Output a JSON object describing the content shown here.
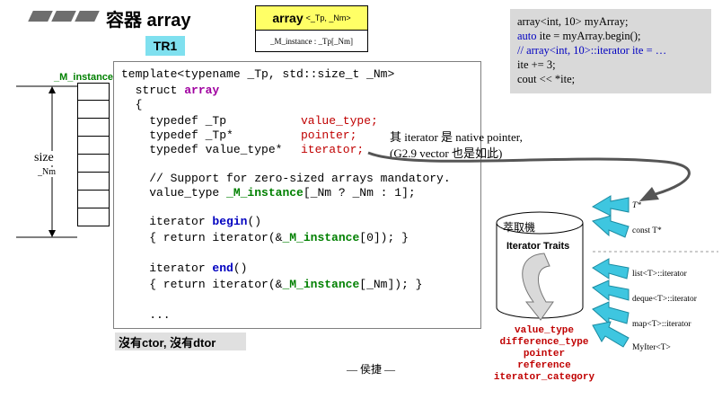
{
  "header": {
    "title": "容器 array",
    "tag": "TR1"
  },
  "array_box": {
    "name": "array",
    "params": "<_Tp, _Nm>",
    "member": "_M_instance : _Tp[_Nm]"
  },
  "memory": {
    "label": "_M_instance",
    "size_label": "size",
    "nm_label": "_Nm"
  },
  "code": {
    "l1": "template<typename _Tp, std::size_t _Nm>",
    "l2a": "  struct ",
    "l2b": "array",
    "l3": "  {",
    "l4a": "    typedef _Tp",
    "l4b": "value_type;",
    "l5a": "    typedef _Tp*",
    "l5b": "pointer;",
    "l6a": "    typedef value_type*",
    "l6b": "iterator;",
    "l7": "    // Support for zero-sized arrays mandatory.",
    "l8a": "    value_type ",
    "l8b": "_M_instance",
    "l8c": "[_Nm ? _Nm : 1];",
    "l9a": "    iterator ",
    "l9b": "begin",
    "l9c": "()",
    "l10a": "    { return iterator(&",
    "l10b": "_M_instance",
    "l10c": "[0]); }",
    "l11a": "    iterator ",
    "l11b": "end",
    "l11c": "()",
    "l12a": "    { return iterator(&",
    "l12b": "_M_instance",
    "l12c": "[_Nm]); }",
    "l13": "    ..."
  },
  "notes": {
    "n1": "其 iterator 是 native pointer,",
    "n2": "(G2.9 vector 也是如此)"
  },
  "no_ctor": "沒有ctor, 沒有dtor",
  "footer": "— 侯捷 —",
  "example": {
    "e1": "array<int, 10> myArray;",
    "e2a": "auto",
    "e2b": " ite = myArray.begin();",
    "e3": "  // array<int, 10>::iterator ite = …",
    "e4": "ite += 3;",
    "e5": "cout << *ite;"
  },
  "traits": {
    "extractor": "萃取機",
    "name": "Iterator Traits",
    "inputs": [
      "T*",
      "const T*",
      "list<T>::iterator",
      "deque<T>::iterator",
      "map<T>::iterator",
      "MyIter<T>"
    ],
    "outputs": [
      "value_type",
      "difference_type",
      "pointer",
      "reference",
      "iterator_category"
    ]
  },
  "colors": {
    "cyan": "#3ec6e0",
    "yellow": "#ffff66",
    "red": "#c00000"
  }
}
